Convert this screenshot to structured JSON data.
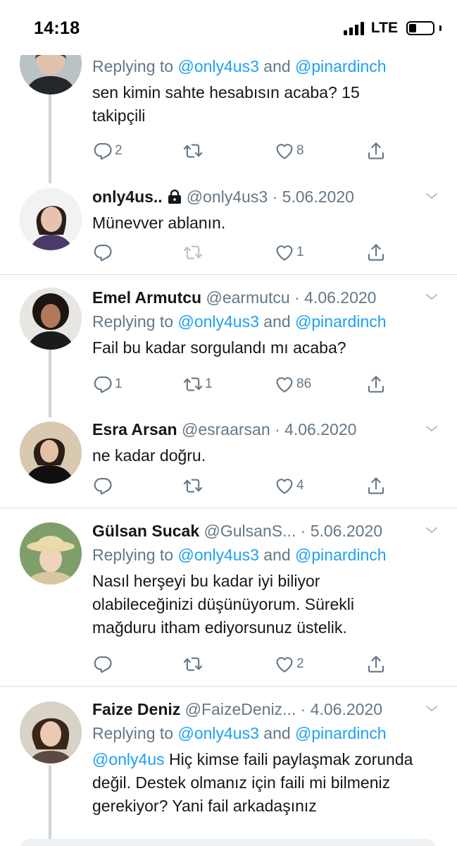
{
  "status_bar": {
    "time": "14:18",
    "network": "LTE",
    "signal_bars": 4,
    "battery_level": 0.3
  },
  "reply_prefix": "Replying to ",
  "reply_join": " and ",
  "tweets": [
    {
      "display_name": "",
      "handle": "",
      "date": "",
      "reply_to": [
        "@only4us3",
        "@pinardinch"
      ],
      "text": "sen kimin sahte hesabısın acaba? 15 takipçili",
      "counts": {
        "reply": "2",
        "retweet": "",
        "like": "8"
      }
    },
    {
      "display_name": "only4us..",
      "locked": true,
      "handle": "@only4us3",
      "date": "5.06.2020",
      "text": "Münevver ablanın.",
      "counts": {
        "reply": "",
        "retweet": "",
        "like": "1"
      }
    },
    {
      "display_name": "Emel Armutcu",
      "handle": "@earmutcu",
      "date": "4.06.2020",
      "reply_to": [
        "@only4us3",
        "@pinardinch"
      ],
      "text": "Fail bu kadar sorgulandı mı acaba?",
      "counts": {
        "reply": "1",
        "retweet": "1",
        "like": "86"
      }
    },
    {
      "display_name": "Esra Arsan",
      "handle": "@esraarsan",
      "date": "4.06.2020",
      "text": "ne kadar doğru.",
      "counts": {
        "reply": "",
        "retweet": "",
        "like": "4"
      }
    },
    {
      "display_name": "Gülsan Sucak",
      "handle": "@GulsanS...",
      "date": "5.06.2020",
      "reply_to": [
        "@only4us3",
        "@pinardinch"
      ],
      "text": "Nasıl herşeyi bu kadar iyi biliyor olabileceğinizi düşünüyorum. Sürekli mağduru itham ediyorsunuz üstelik.",
      "counts": {
        "reply": "",
        "retweet": "",
        "like": "2"
      }
    },
    {
      "display_name": "Faize Deniz",
      "handle": "@FaizeDeniz...",
      "date": "4.06.2020",
      "reply_to": [
        "@only4us3",
        "@pinardinch"
      ],
      "text_mention": "@only4us",
      "text": " Hiç kimse faili paylaşmak zorunda değil. Destek olmanız için faili mi bilmeniz gerekiyor? Yani fail arkadaşınız",
      "counts": {
        "reply": "",
        "retweet": "",
        "like": ""
      }
    }
  ],
  "colors": {
    "link": "#1da1f2",
    "muted": "#657786",
    "text": "#14171a",
    "divider": "#d9dde1"
  },
  "icons": [
    "reply-icon",
    "retweet-icon",
    "like-icon",
    "share-icon",
    "chevron-down-icon",
    "lock-icon"
  ]
}
